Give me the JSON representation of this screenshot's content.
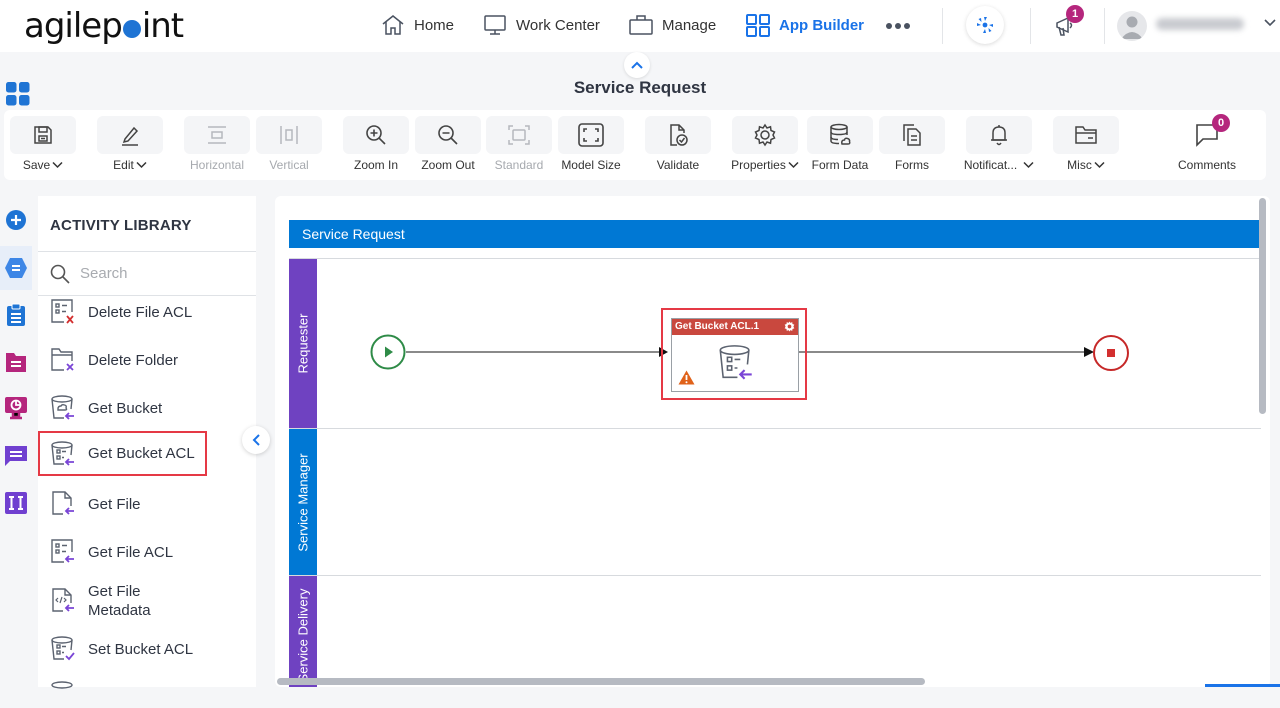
{
  "header": {
    "logo_text_left": "agilep",
    "logo_text_right": "int",
    "nav": [
      {
        "label": "Home",
        "icon": "home-icon"
      },
      {
        "label": "Work Center",
        "icon": "monitor-icon"
      },
      {
        "label": "Manage",
        "icon": "briefcase-icon"
      },
      {
        "label": "App Builder",
        "icon": "grid-icon",
        "active": true
      }
    ],
    "more_icon": "more-dots-icon",
    "ai_icon": "pinwheel-icon",
    "notifications_count": "1",
    "user_name": "(blurred)"
  },
  "title_bar": {
    "title": "Service Request"
  },
  "toolbar": {
    "items": [
      {
        "label": "Save",
        "icon": "save-icon",
        "dropdown": true,
        "enabled": true
      },
      {
        "label": "Edit",
        "icon": "edit-icon",
        "dropdown": true,
        "enabled": true
      },
      {
        "label": "Horizontal",
        "icon": "horizontal-layout-icon",
        "dropdown": false,
        "enabled": false
      },
      {
        "label": "Vertical",
        "icon": "vertical-layout-icon",
        "dropdown": false,
        "enabled": false
      },
      {
        "label": "Zoom In",
        "icon": "zoom-in-icon",
        "dropdown": false,
        "enabled": true
      },
      {
        "label": "Zoom Out",
        "icon": "zoom-out-icon",
        "dropdown": false,
        "enabled": true
      },
      {
        "label": "Standard",
        "icon": "standard-size-icon",
        "dropdown": false,
        "enabled": false
      },
      {
        "label": "Model Size",
        "icon": "model-size-icon",
        "dropdown": false,
        "enabled": true
      },
      {
        "label": "Validate",
        "icon": "validate-icon",
        "dropdown": false,
        "enabled": true
      },
      {
        "label": "Properties",
        "icon": "gear-icon",
        "dropdown": true,
        "enabled": true
      },
      {
        "label": "Form Data",
        "icon": "database-icon",
        "dropdown": false,
        "enabled": true
      },
      {
        "label": "Forms",
        "icon": "forms-icon",
        "dropdown": false,
        "enabled": true
      },
      {
        "label": "Notificat...",
        "icon": "bell-icon",
        "dropdown": true,
        "enabled": true
      },
      {
        "label": "Misc",
        "icon": "folder-icon",
        "dropdown": true,
        "enabled": true
      },
      {
        "label": "Comments",
        "icon": "comment-icon",
        "dropdown": false,
        "enabled": true,
        "badge": "0"
      }
    ]
  },
  "rail": [
    {
      "name": "add",
      "color": "#1f74d4"
    },
    {
      "name": "activities",
      "color": "#3d86e6",
      "active": true
    },
    {
      "name": "clipboard",
      "color": "#1f74d4"
    },
    {
      "name": "folder",
      "color": "#b5267d"
    },
    {
      "name": "reports",
      "color": "#b5267d"
    },
    {
      "name": "chat",
      "color": "#7040d0"
    },
    {
      "name": "variables",
      "color": "#7040d0"
    }
  ],
  "library": {
    "title": "ACTIVITY LIBRARY",
    "search_placeholder": "Search",
    "search_value": "",
    "items": [
      {
        "label": "Delete File ACL",
        "icon": "delete-file-acl-icon"
      },
      {
        "label": "Delete Folder",
        "icon": "delete-folder-icon"
      },
      {
        "label": "Get Bucket",
        "icon": "get-bucket-icon"
      },
      {
        "label": "Get Bucket ACL",
        "icon": "get-bucket-acl-icon",
        "highlighted": true
      },
      {
        "label": "Get File",
        "icon": "get-file-icon"
      },
      {
        "label": "Get File ACL",
        "icon": "get-file-acl-icon"
      },
      {
        "label": "Get File\nMetadata",
        "line1": "Get File",
        "line2": "Metadata",
        "icon": "get-file-metadata-icon"
      },
      {
        "label": "Set Bucket ACL",
        "icon": "set-bucket-acl-icon"
      }
    ]
  },
  "canvas": {
    "pool_title": "Service Request",
    "lanes": [
      {
        "label": "Requester",
        "color": "#6f42c1"
      },
      {
        "label": "Service Manager",
        "color": "#0078d4"
      },
      {
        "label": "Service Delivery",
        "color": "#6f42c1"
      }
    ],
    "activity": {
      "title": "Get Bucket ACL.1",
      "warning": true
    },
    "colors": {
      "start": "#2e8b47",
      "end": "#c62828",
      "activity_header": "#c9483e",
      "highlight": "#e53945"
    }
  }
}
